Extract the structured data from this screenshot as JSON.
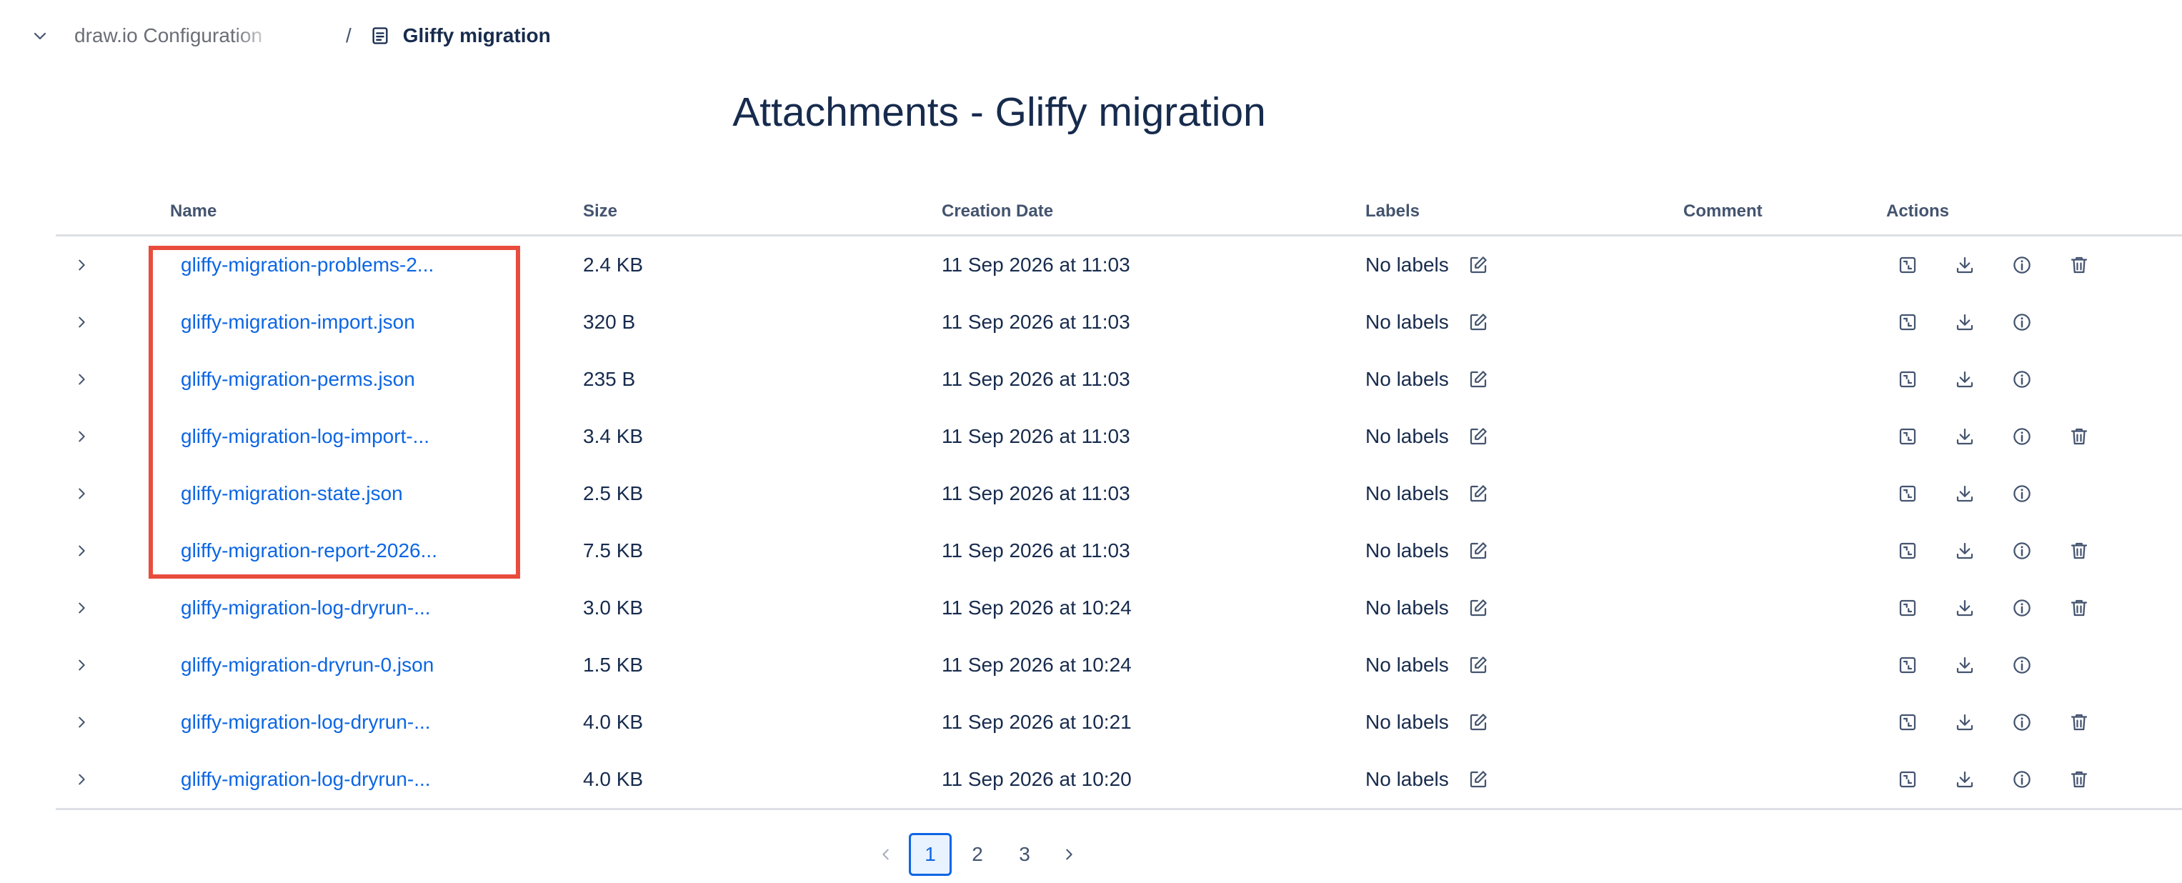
{
  "breadcrumb": {
    "parent": "draw.io Configuration",
    "separator": "/",
    "current": "Gliffy migration"
  },
  "title": "Attachments - Gliffy migration",
  "columns": {
    "name": "Name",
    "size": "Size",
    "date": "Creation Date",
    "labels": "Labels",
    "comment": "Comment",
    "actions": "Actions"
  },
  "rows": [
    {
      "name": "gliffy-migration-problems-2...",
      "size": "2.4 KB",
      "date": "11 Sep 2026 at 11:03",
      "labels": "No labels",
      "deletable": true
    },
    {
      "name": "gliffy-migration-import.json",
      "size": "320 B",
      "date": "11 Sep 2026 at 11:03",
      "labels": "No labels",
      "deletable": false
    },
    {
      "name": "gliffy-migration-perms.json",
      "size": "235 B",
      "date": "11 Sep 2026 at 11:03",
      "labels": "No labels",
      "deletable": false
    },
    {
      "name": "gliffy-migration-log-import-...",
      "size": "3.4 KB",
      "date": "11 Sep 2026 at 11:03",
      "labels": "No labels",
      "deletable": true
    },
    {
      "name": "gliffy-migration-state.json",
      "size": "2.5 KB",
      "date": "11 Sep 2026 at 11:03",
      "labels": "No labels",
      "deletable": false
    },
    {
      "name": "gliffy-migration-report-2026...",
      "size": "7.5 KB",
      "date": "11 Sep 2026 at 11:03",
      "labels": "No labels",
      "deletable": true
    },
    {
      "name": "gliffy-migration-log-dryrun-...",
      "size": "3.0 KB",
      "date": "11 Sep 2026 at 10:24",
      "labels": "No labels",
      "deletable": true
    },
    {
      "name": "gliffy-migration-dryrun-0.json",
      "size": "1.5 KB",
      "date": "11 Sep 2026 at 10:24",
      "labels": "No labels",
      "deletable": false
    },
    {
      "name": "gliffy-migration-log-dryrun-...",
      "size": "4.0 KB",
      "date": "11 Sep 2026 at 10:21",
      "labels": "No labels",
      "deletable": true
    },
    {
      "name": "gliffy-migration-log-dryrun-...",
      "size": "4.0 KB",
      "date": "11 Sep 2026 at 10:20",
      "labels": "No labels",
      "deletable": true
    }
  ],
  "pagination": {
    "pages": [
      "1",
      "2",
      "3"
    ],
    "current": "1"
  },
  "colors": {
    "link": "#0c66e4",
    "highlight": "#e84c3d",
    "text": "#172b4d",
    "border": "#dcdfe4"
  },
  "icons": {
    "row_actions": [
      "preview-icon",
      "download-icon",
      "info-icon",
      "trash-icon"
    ],
    "labels_edit": "edit-icon",
    "expander": "chevron-right-icon"
  }
}
